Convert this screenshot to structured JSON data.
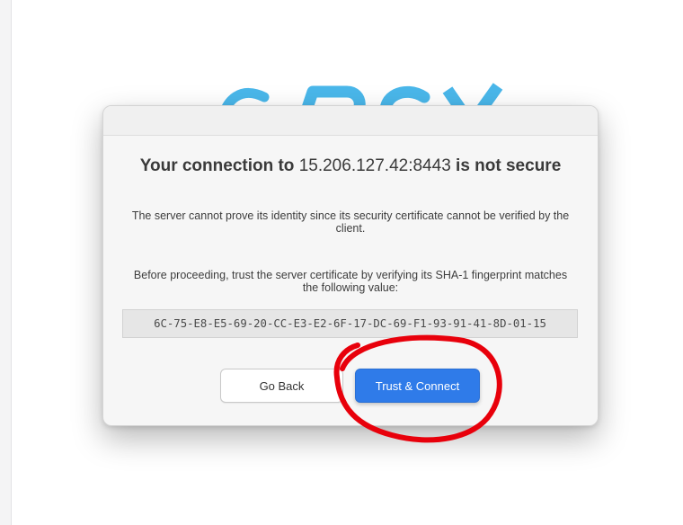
{
  "dialog": {
    "heading_prefix": "Your connection to",
    "address": "15.206.127.42:8443",
    "heading_suffix": "is not secure",
    "message": "The server cannot prove its identity since its security certificate cannot be verified by the client.",
    "instruction": "Before proceeding, trust the server certificate by verifying its SHA-1 fingerprint matches the following value:",
    "fingerprint": "6C-75-E8-E5-69-20-CC-E3-E2-6F-17-DC-69-F1-93-91-41-8D-01-15",
    "buttons": {
      "back_label": "Go Back",
      "trust_label": "Trust & Connect"
    }
  },
  "colors": {
    "primary_button": "#2f7be9",
    "annotation": "#e8000b",
    "logo_accent": "#4ab7ea"
  },
  "icons": {
    "background_logo": "pcv-logo"
  }
}
